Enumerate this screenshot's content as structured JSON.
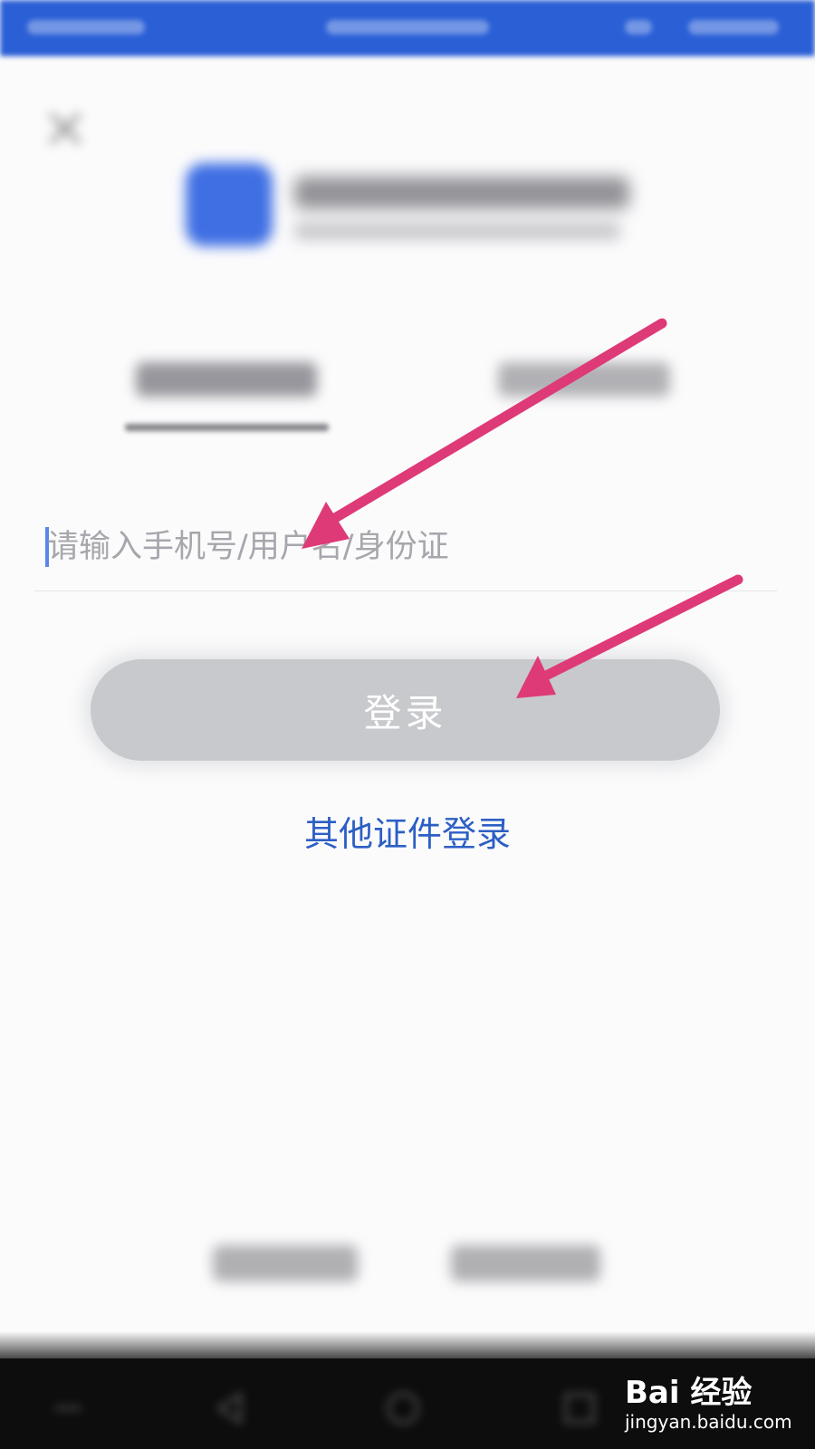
{
  "login_form": {
    "account_placeholder": "请输入手机号/用户名/身份证",
    "login_button_label": "登录",
    "other_credentials_link": "其他证件登录"
  },
  "watermark": {
    "logo_text": "Bai 经验",
    "url": "jingyan.baidu.com"
  },
  "colors": {
    "status_bar": "#2a5fd6",
    "link": "#2d5fc4",
    "button_disabled": "#c8c9cd",
    "annotation_arrow": "#de3a78"
  }
}
